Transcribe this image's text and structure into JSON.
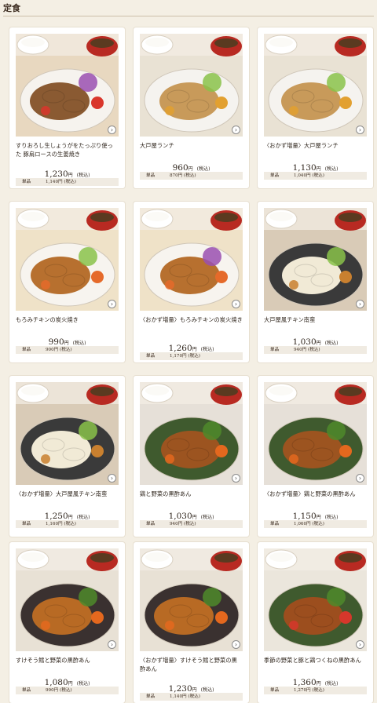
{
  "page": {
    "title": "定食"
  },
  "currency": {
    "yen": "円",
    "tax": "(税込)",
    "single_label": "単品"
  },
  "items": [
    {
      "name": "すりおろし生しょうがをたっぷり使った 豚肩ロースの生姜焼き",
      "price": "1,230",
      "single_price": "1,140円 (税込)"
    },
    {
      "name": "大戸屋ランチ",
      "price": "960",
      "single_price": "870円 (税込)"
    },
    {
      "name": "〈おかず増量〉大戸屋ランチ",
      "price": "1,130",
      "single_price": "1,040円 (税込)"
    },
    {
      "name": "もろみチキンの炭火焼き",
      "price": "990",
      "single_price": "900円 (税込)"
    },
    {
      "name": "〈おかず増量〉もろみチキンの炭火焼き",
      "price": "1,260",
      "single_price": "1,170円 (税込)"
    },
    {
      "name": "大戸屋風チキン南蛮",
      "price": "1,030",
      "single_price": "940円 (税込)"
    },
    {
      "name": "〈おかず増量〉大戸屋風チキン南蛮",
      "price": "1,250",
      "single_price": "1,160円 (税込)"
    },
    {
      "name": "鶏と野菜の黒酢あん",
      "price": "1,030",
      "single_price": "940円 (税込)"
    },
    {
      "name": "〈おかず増量〉鶏と野菜の黒酢あん",
      "price": "1,150",
      "single_price": "1,060円 (税込)"
    },
    {
      "name": "すけそう鱈と野菜の黒酢あん",
      "price": "1,080",
      "single_price": "990円 (税込)"
    },
    {
      "name": "〈おかず増量〉すけそう鱈と野菜の黒酢あん",
      "price": "1,230",
      "single_price": "1,140円 (税込)"
    },
    {
      "name": "季節の野菜と豚と鶏つくねの黒酢あん",
      "price": "1,360",
      "single_price": "1,270円 (税込)"
    }
  ],
  "icons": {
    "arrow": "chevron-right-icon"
  },
  "colors": {
    "background": "#f4efe4",
    "card": "#ffffff",
    "single_bg": "#f0ebe2"
  }
}
